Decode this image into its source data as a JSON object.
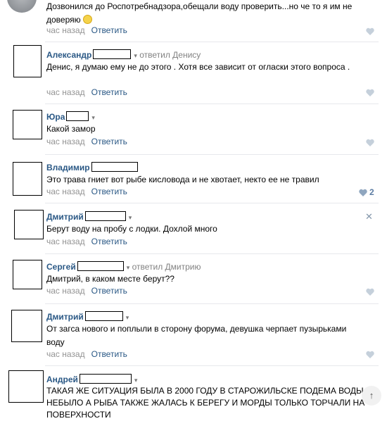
{
  "comments": [
    {
      "author": "",
      "text": "Дозвонился до Роспотребнадзора,обещали воду проверить...но че то я им не доверяю",
      "time": "час назад",
      "reply": "Ответить"
    },
    {
      "author": "Александр",
      "replied_to": "ответил Денису",
      "text": "Денис, я думаю ему не до этого . Хотя все зависит от огласки этого вопроса .",
      "time": "час назад",
      "reply": "Ответить"
    },
    {
      "author": "Юра",
      "text": "Какой замор",
      "time": "час назад",
      "reply": "Ответить"
    },
    {
      "author": "Владимир",
      "text": "Это трава гниет вот рыбе кисловодa и не хвотает, некто ее не травил",
      "time": "час назад",
      "reply": "Ответить",
      "likes": "2"
    },
    {
      "author": "Дмитрий",
      "text": "Берут воду на пробу с лодки. Дохлой много",
      "time": "час назад",
      "reply": "Ответить"
    },
    {
      "author": "Сергей",
      "replied_to": "ответил Дмитрию",
      "text": "Дмитрий, в каком месте берут??",
      "time": "час назад",
      "reply": "Ответить"
    },
    {
      "author": "Дмитрий",
      "text": "От загса нового и поплыли в сторону форума, девушка черпает пузырьками воду",
      "time": "час назад",
      "reply": "Ответить"
    },
    {
      "author": "Андрей",
      "text": "ТАКАЯ ЖЕ СИТУАЦИЯ БЫЛА В 2000 ГОДУ В СТАРОЖИЛЬСКЕ ПОДЕМА ВОДЫ НЕБЫЛО А РЫБА ТАКЖЕ ЖАЛАСЬ К БЕРЕГУ И МОРДЫ ТОЛЬКО ТОРЧАЛИ НА ПОВЕРХНОСТИ"
    }
  ],
  "colors": {
    "link": "#2a5885",
    "muted": "#939393",
    "separator": "#e7e8ec"
  },
  "icons": [
    "heart-icon",
    "close-icon",
    "smile-emoji",
    "scroll-up-icon"
  ],
  "scroll_badge": "↑"
}
